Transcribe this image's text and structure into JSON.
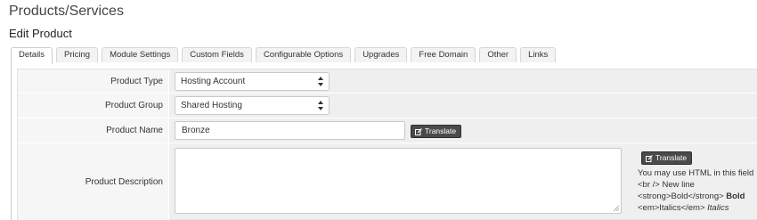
{
  "page": {
    "title": "Products/Services",
    "subtitle": "Edit Product"
  },
  "tabs": [
    {
      "label": "Details",
      "active": true
    },
    {
      "label": "Pricing"
    },
    {
      "label": "Module Settings"
    },
    {
      "label": "Custom Fields"
    },
    {
      "label": "Configurable Options"
    },
    {
      "label": "Upgrades"
    },
    {
      "label": "Free Domain"
    },
    {
      "label": "Other"
    },
    {
      "label": "Links"
    }
  ],
  "form": {
    "product_type": {
      "label": "Product Type",
      "value": "Hosting Account"
    },
    "product_group": {
      "label": "Product Group",
      "value": "Shared Hosting"
    },
    "product_name": {
      "label": "Product Name",
      "value": "Bronze"
    },
    "product_description": {
      "label": "Product Description",
      "value": ""
    },
    "translate_label": "Translate",
    "help": {
      "line1": "You may use HTML in this field",
      "line2_code": "<br />",
      "line2_text": "New line",
      "line3_code": "<strong>Bold</strong>",
      "line3_text": "Bold",
      "line4_code": "<em>Italics</em>",
      "line4_text": "Italics"
    }
  },
  "icons": {
    "translate": "edit-square-icon",
    "select_arrows": "up-down-arrows-icon"
  }
}
